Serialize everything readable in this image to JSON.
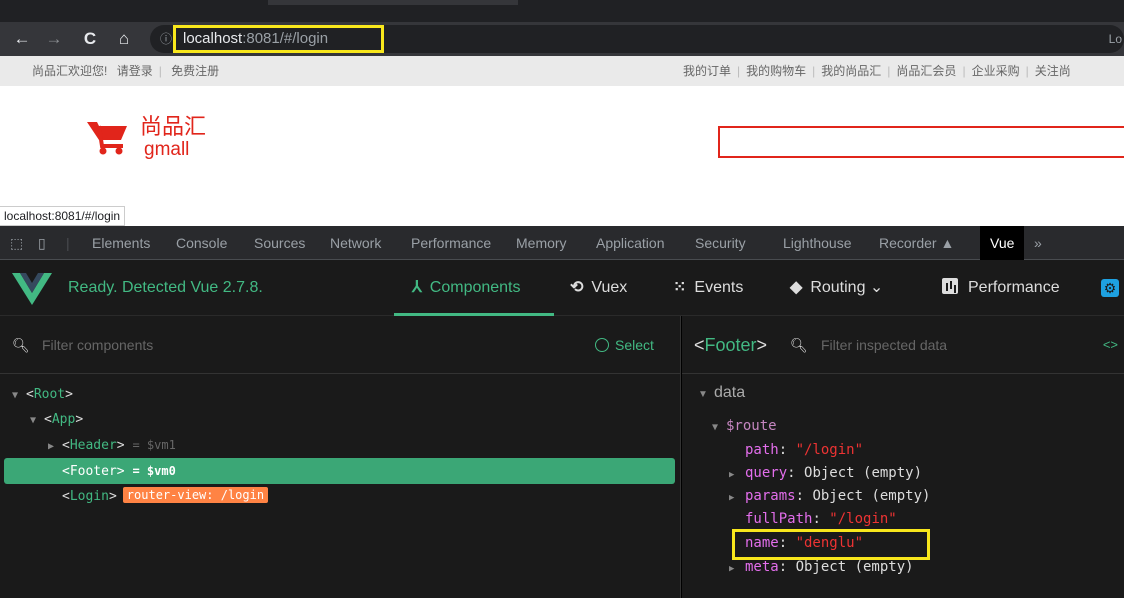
{
  "browser": {
    "url_host": "localhost",
    "url_rest": ":8081/#/login",
    "nav": {
      "back": "←",
      "forward": "→",
      "reload": "C",
      "home": "⌂"
    },
    "info_icon": "ⓘ",
    "right_partial": "Lo"
  },
  "page": {
    "shortcut_left": {
      "welcome": "尚品汇欢迎您!",
      "login": "请登录",
      "sep": "|",
      "register": "免费注册"
    },
    "shortcut_right": [
      "我的订单",
      "我的购物车",
      "我的尚品汇",
      "尚品汇会员",
      "企业采购",
      "关注尚"
    ],
    "logo_cn": "尚品汇",
    "logo_en": "gmall",
    "status_url": "localhost:8081/#/login"
  },
  "devtools": {
    "tabs": [
      "Elements",
      "Console",
      "Sources",
      "Network",
      "Performance",
      "Memory",
      "Application",
      "Security",
      "Lighthouse",
      "Recorder"
    ],
    "active_tab": "Vue",
    "more": "»"
  },
  "vue": {
    "ready_text": "Ready. Detected Vue 2.7.8.",
    "nav": {
      "components": "Components",
      "vuex": "Vuex",
      "events": "Events",
      "routing": "Routing",
      "performance": "Performance"
    },
    "filter_placeholder": "Filter components",
    "select_label": "Select",
    "tree": [
      {
        "name": "Root",
        "arrow": "▼"
      },
      {
        "name": "App",
        "arrow": "▼"
      },
      {
        "name": "Header",
        "arrow": "▶",
        "ref": "= $vm1"
      },
      {
        "name": "Footer",
        "ref": "= $vm0"
      },
      {
        "name": "Login",
        "badge": "router-view: /login"
      }
    ],
    "inspector": {
      "component": "Footer",
      "filter_placeholder": "Filter inspected data",
      "code_icon": "<>",
      "section": "data",
      "route_key": "$route",
      "props": [
        {
          "key": "path",
          "value": "\"/login\""
        },
        {
          "key": "query",
          "value": "Object (empty)"
        },
        {
          "key": "params",
          "value": "Object (empty)"
        },
        {
          "key": "fullPath",
          "value": "\"/login\""
        },
        {
          "key": "name",
          "value": "\"denglu\""
        },
        {
          "key": "meta",
          "value": "Object (empty)"
        }
      ]
    }
  }
}
